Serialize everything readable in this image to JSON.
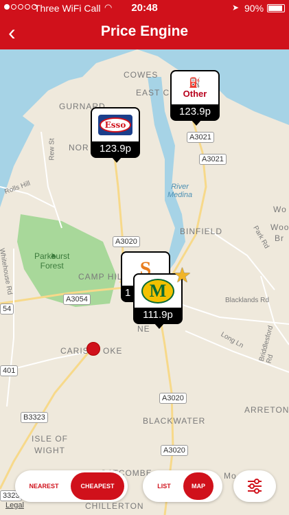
{
  "status": {
    "carrier": "Three WiFi Call",
    "time": "20:48",
    "battery": "90%"
  },
  "nav": {
    "title": "Price Engine",
    "back_icon": "chevron-left-icon"
  },
  "map": {
    "places": {
      "cowes": "COWES",
      "east_cowes": "EAST C",
      "gurnard": "GURNARD",
      "northwood": "NOR",
      "binfield": "BINFIELD",
      "camp_hill": "CAMP HIL",
      "newport": "NE",
      "carisbrooke_a": "CARIS",
      "carisbrooke_b": "OKE",
      "blackwater": "BLACKWATER",
      "isle_of": "ISLE OF",
      "wight": "WIGHT",
      "arreton": "ARRETON",
      "gatcombe": "GATCOMBE",
      "chillerton": "CHILLERTON",
      "wo": "Wo",
      "woo": "Woo",
      "br": "Br",
      "mo": "Mo"
    },
    "streets": {
      "rew_st": "Rew St",
      "rolls_hill": "Rolls Hill",
      "whitehouse_rd": "Whitehouse Rd",
      "park_rd": "Park Rd",
      "blacklands_rd": "Blacklands Rd",
      "long_ln": "Long Ln",
      "briddlesford_rd": "Briddlesford Rd"
    },
    "roads": {
      "a3021_a": "A3021",
      "a3021_b": "A3021",
      "a3020_a": "A3020",
      "a3054": "A3054",
      "a3020_b": "A3020",
      "a3020_c": "A3020",
      "b3323": "B3323",
      "r401": "401",
      "r54": "54",
      "r3323": "3323"
    },
    "water": "River\nMedina",
    "forest": "Parkhurst\nForest",
    "legal": "Legal"
  },
  "stations": [
    {
      "brand": "Esso",
      "price": "123.9p"
    },
    {
      "brand": "Other",
      "price": "123.9p"
    },
    {
      "brand": "S",
      "price": "1"
    },
    {
      "brand": "M",
      "price": "111.9p"
    }
  ],
  "controls": {
    "sort": {
      "nearest": "NEAREST",
      "cheapest": "CHEAPEST",
      "active": "CHEAPEST"
    },
    "view": {
      "list": "LIST",
      "map": "MAP",
      "active": "MAP"
    },
    "filter_icon": "sliders-icon"
  },
  "colors": {
    "brand_red": "#d0111b",
    "sea": "#a6d3e6",
    "forest": "#a8d89a",
    "star": "#f0b429"
  }
}
